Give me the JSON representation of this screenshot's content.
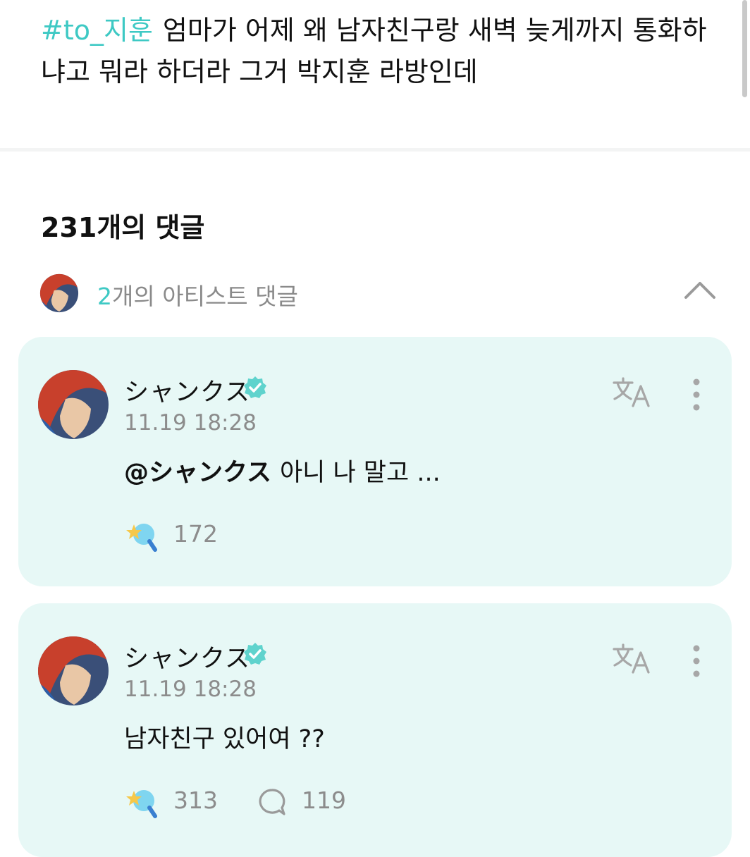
{
  "post": {
    "tag": "#to_지훈",
    "text": "엄마가 어제 왜 남자친구랑 새벽 늦게까지 통화하냐고 뭐라 하더라 그거 박지훈 라방인데"
  },
  "comments_header": {
    "count_label": "231개의 댓글"
  },
  "artist_comments": {
    "count": "2",
    "label": "개의 아티스트 댓글"
  },
  "comments": [
    {
      "author": "シャンクス",
      "time": "11.19 18:28",
      "mention": "@シャンクス",
      "text": "아니 나 말고 ...",
      "likes": "172"
    },
    {
      "author": "シャンクス",
      "time": "11.19 18:28",
      "mention": "",
      "text": "남자친구 있어여 ??",
      "likes": "313",
      "replies": "119"
    }
  ],
  "colors": {
    "accent": "#3ec9c4",
    "card_bg": "#e7f8f6",
    "muted_text": "#8c8c8c"
  },
  "icons": [
    "verified-badge-icon",
    "translate-icon",
    "more-vertical-icon",
    "chevron-up-icon",
    "star-reaction-icon",
    "reply-bubble-icon"
  ]
}
